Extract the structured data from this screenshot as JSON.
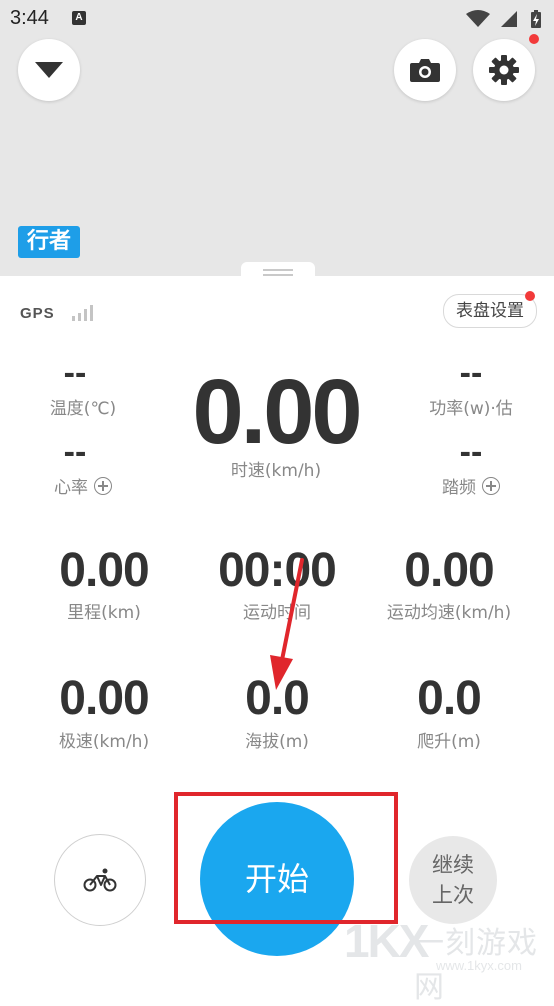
{
  "status_bar": {
    "time": "3:44",
    "badge": "A"
  },
  "map": {
    "logo_text": "行者"
  },
  "gps": {
    "label": "GPS"
  },
  "dial_settings": {
    "label": "表盘设置"
  },
  "top_metrics": {
    "temperature": {
      "value": "--",
      "label": "温度(℃)"
    },
    "heart_rate": {
      "value": "--",
      "label": "心率"
    },
    "power": {
      "value": "--",
      "label": "功率(w)·估"
    },
    "cadence": {
      "value": "--",
      "label": "踏频"
    }
  },
  "speed": {
    "value": "0.00",
    "label": "时速(km/h)"
  },
  "grid_metrics": [
    {
      "value": "0.00",
      "label": "里程(km)"
    },
    {
      "value": "00:00",
      "label": "运动时间"
    },
    {
      "value": "0.00",
      "label": "运动均速(km/h)"
    },
    {
      "value": "0.00",
      "label": "极速(km/h)"
    },
    {
      "value": "0.0",
      "label": "海拔(m)"
    },
    {
      "value": "0.0",
      "label": "爬升(m)"
    }
  ],
  "actions": {
    "start_label": "开始",
    "resume_line1": "继续",
    "resume_line2": "上次"
  },
  "watermark": {
    "mark": "1KX",
    "brand": "一刻游戏网",
    "url": "www.1kyx.com"
  },
  "colors": {
    "accent": "#1aa7ef",
    "logo": "#1e9ee8",
    "notification": "#f23a3a",
    "annotation": "#e0262c"
  }
}
